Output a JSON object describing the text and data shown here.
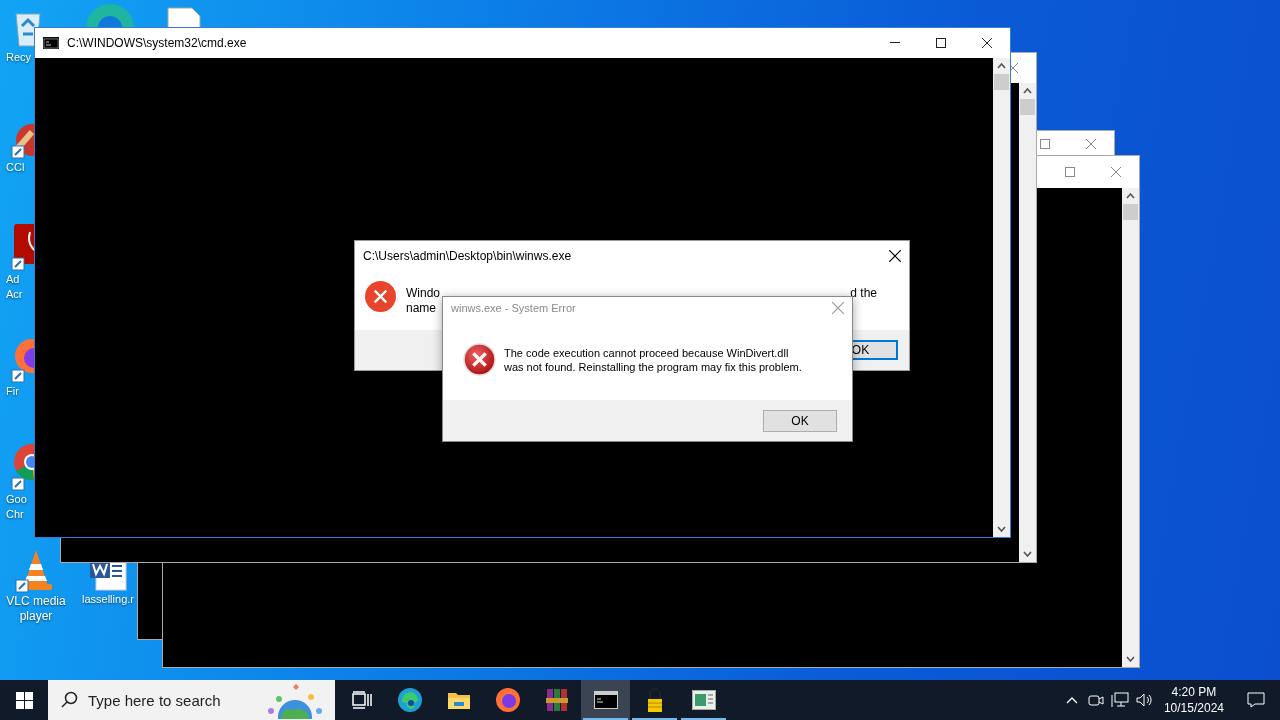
{
  "desktop_icons": [
    {
      "kind": "recycle-bin",
      "label": [
        "Recy"
      ]
    },
    {
      "kind": "edge"
    },
    {
      "kind": "document"
    },
    {
      "kind": "ccleaner",
      "label": [
        "CCl"
      ]
    },
    {
      "kind": "acrobat",
      "label": [
        "Ad",
        "Acr"
      ]
    },
    {
      "kind": "firefox",
      "label": [
        "Fir"
      ]
    },
    {
      "kind": "chrome",
      "label": [
        "Goo",
        "Chr"
      ]
    },
    {
      "kind": "vlc",
      "label": [
        "VLC media",
        "player"
      ]
    },
    {
      "kind": "word",
      "label": [
        "lasselling.r"
      ]
    }
  ],
  "background_windows": [
    {
      "kind": "console"
    },
    {
      "kind": "console"
    },
    {
      "kind": "console"
    }
  ],
  "console_window": {
    "title": "C:\\WINDOWS\\system32\\cmd.exe"
  },
  "dialogs": [
    {
      "title": "C:\\Users\\admin\\Desktop\\bin\\winws.exe",
      "active": true,
      "message_lines": [
        [
          "Windo",
          "d the"
        ],
        [
          "name"
        ]
      ],
      "button": "OK",
      "button_focused": true
    },
    {
      "title": "winws.exe - System Error",
      "active": false,
      "message_lines": [
        [
          "The code execution cannot proceed because WinDivert.dll"
        ],
        [
          "was not found. Reinstalling the program may fix this problem."
        ]
      ],
      "button": "OK",
      "button_focused": false
    }
  ],
  "taskbar": {
    "search": {
      "placeholder": "Type here to search"
    },
    "apps": [
      {
        "kind": "task-view",
        "open": false,
        "active": false
      },
      {
        "kind": "edge",
        "open": false,
        "active": false
      },
      {
        "kind": "explorer",
        "open": false,
        "active": false
      },
      {
        "kind": "firefox",
        "open": false,
        "active": false
      },
      {
        "kind": "winrar",
        "open": false,
        "active": false
      },
      {
        "kind": "console",
        "open": true,
        "active": true
      },
      {
        "kind": "padlock",
        "open": true,
        "active": false
      },
      {
        "kind": "app-window",
        "open": true,
        "active": false
      }
    ],
    "tray": {
      "time": "4:20 PM",
      "date": "10/15/2024"
    }
  }
}
